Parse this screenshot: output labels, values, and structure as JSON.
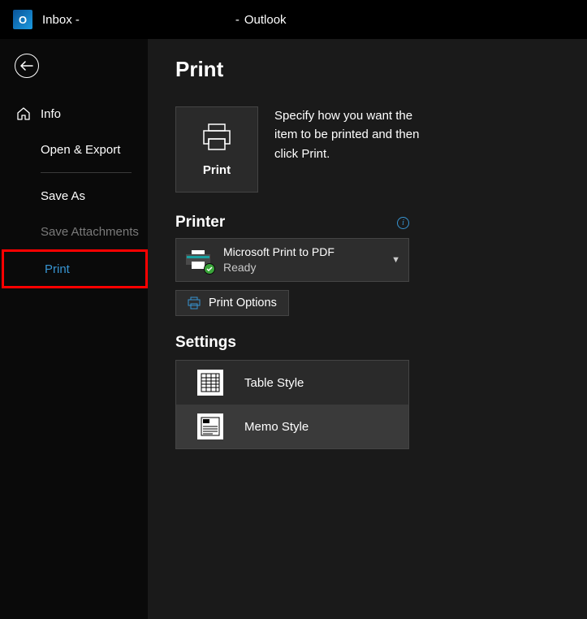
{
  "titlebar": {
    "app_glyph": "O",
    "prefix": "Inbox -",
    "dash": "-",
    "app_name": "Outlook"
  },
  "sidebar": {
    "info": "Info",
    "open_export": "Open & Export",
    "save_as": "Save As",
    "save_attachments": "Save Attachments",
    "print": "Print"
  },
  "page": {
    "title": "Print",
    "print_button": "Print",
    "description": "Specify how you want the item to be printed and then click Print.",
    "printer_heading": "Printer",
    "printer_name": "Microsoft Print to PDF",
    "printer_status": "Ready",
    "print_options": "Print Options",
    "settings_heading": "Settings",
    "style_table": "Table Style",
    "style_memo": "Memo Style"
  }
}
